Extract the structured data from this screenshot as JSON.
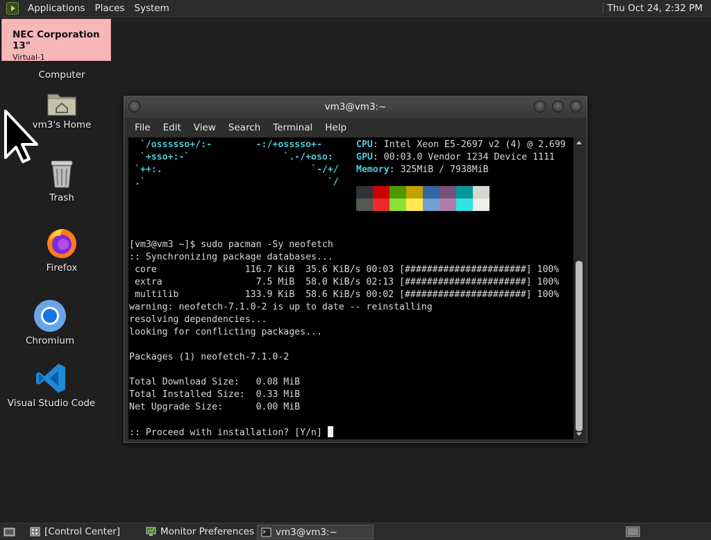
{
  "top_panel": {
    "menus": [
      "Applications",
      "Places",
      "System"
    ],
    "clock": "Thu Oct 24,  2:32 PM"
  },
  "monitor_label": {
    "title": "NEC Corporation 13\"",
    "subtitle": "Virtual-1"
  },
  "desktop_icons": {
    "computer": "Computer",
    "home": "vm3's Home",
    "trash": "Trash",
    "firefox": "Firefox",
    "chromium": "Chromium",
    "vscode": "Visual Studio Code"
  },
  "terminal": {
    "title": "vm3@vm3:~",
    "menu": [
      "File",
      "Edit",
      "View",
      "Search",
      "Terminal",
      "Help"
    ],
    "logo_lines": [
      "  `/ossssso+/:-        -:/+osssso+-",
      "  `+sso+:-`                 `.-/+oso:",
      " `++:.                           `-/+/",
      " .`                                 `/"
    ],
    "info": [
      {
        "key": "CPU",
        "value": ": Intel Xeon E5-2697 v2 (4) @ 2.699"
      },
      {
        "key": "GPU",
        "value": ": 00:03.0 Vendor 1234 Device 1111"
      },
      {
        "key": "Memory",
        "value": ": 325MiB / 7938MiB"
      }
    ],
    "palette_top": [
      "#2e3436",
      "#cc0000",
      "#4e9a06",
      "#c4a000",
      "#3465a4",
      "#75507b",
      "#06989a",
      "#d3d7cf"
    ],
    "palette_bottom": [
      "#555753",
      "#ef2929",
      "#8ae234",
      "#fce94f",
      "#729fcf",
      "#ad7fa8",
      "#34e2e2",
      "#eeeeec"
    ],
    "output": [
      "[vm3@vm3 ~]$ sudo pacman -Sy neofetch",
      ":: Synchronizing package databases...",
      " core                116.7 KiB  35.6 KiB/s 00:03 [######################] 100%",
      " extra                 7.5 MiB  58.0 KiB/s 02:13 [######################] 100%",
      " multilib            133.9 KiB  58.6 KiB/s 00:02 [######################] 100%",
      "warning: neofetch-7.1.0-2 is up to date -- reinstalling",
      "resolving dependencies...",
      "looking for conflicting packages...",
      "",
      "Packages (1) neofetch-7.1.0-2",
      "",
      "Total Download Size:   0.08 MiB",
      "Total Installed Size:  0.33 MiB",
      "Net Upgrade Size:      0.00 MiB",
      "",
      ":: Proceed with installation? [Y/n] "
    ]
  },
  "taskbar": {
    "tasks": [
      "[Control Center]",
      "Monitor Preferences",
      "vm3@vm3:~"
    ]
  }
}
